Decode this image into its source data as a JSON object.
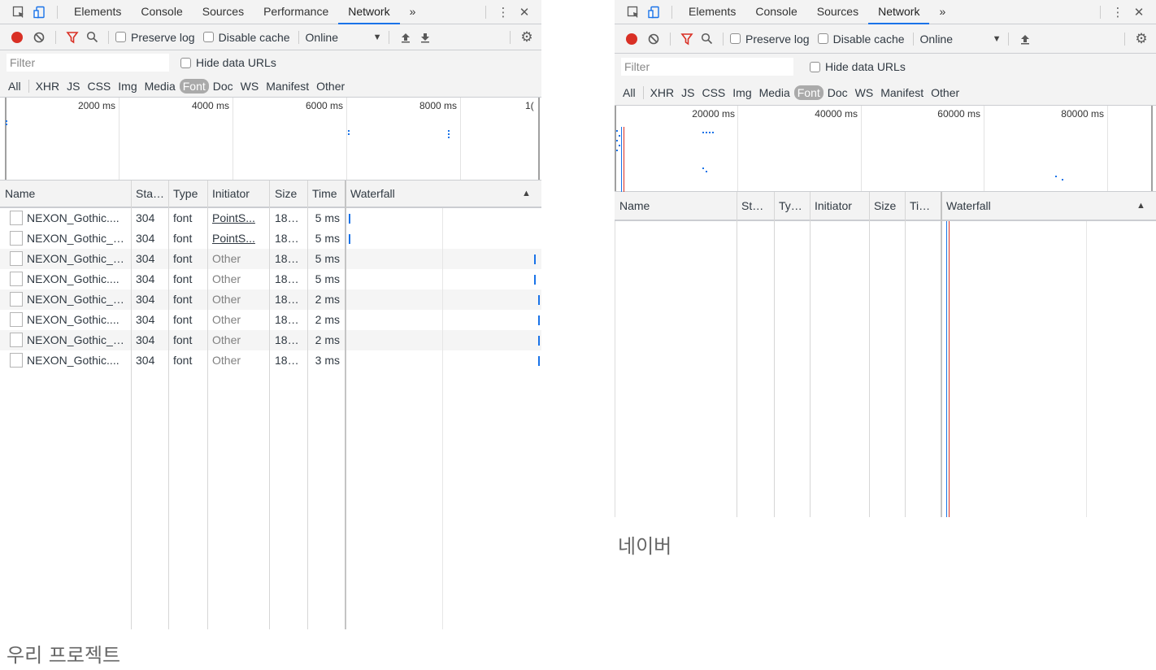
{
  "panels": [
    {
      "tabs": [
        "Elements",
        "Console",
        "Sources",
        "Performance",
        "Network"
      ],
      "selected_tab": "Network",
      "more_tabs": "»",
      "toolbar": {
        "preserve_log": "Preserve log",
        "disable_cache": "Disable cache",
        "throttle": "Online"
      },
      "filter": {
        "placeholder": "Filter",
        "hide_data_urls": "Hide data URLs"
      },
      "type_filters": [
        "All",
        "XHR",
        "JS",
        "CSS",
        "Img",
        "Media",
        "Font",
        "Doc",
        "WS",
        "Manifest",
        "Other"
      ],
      "selected_type": "Font",
      "overview_labels": [
        "2000 ms",
        "4000 ms",
        "6000 ms",
        "8000 ms",
        "1("
      ],
      "columns": [
        "Name",
        "Sta…",
        "Type",
        "Initiator",
        "Size",
        "Time",
        "Waterfall"
      ],
      "rows": [
        {
          "name": "NEXON_Gothic....",
          "status": "304",
          "type": "font",
          "initiator": "PointS...",
          "size": "18…",
          "time": "5 ms"
        },
        {
          "name": "NEXON_Gothic_…",
          "status": "304",
          "type": "font",
          "initiator": "PointS...",
          "size": "18…",
          "time": "5 ms"
        },
        {
          "name": "NEXON_Gothic_…",
          "status": "304",
          "type": "font",
          "initiator": "Other",
          "size": "18…",
          "time": "5 ms"
        },
        {
          "name": "NEXON_Gothic....",
          "status": "304",
          "type": "font",
          "initiator": "Other",
          "size": "18…",
          "time": "5 ms"
        },
        {
          "name": "NEXON_Gothic_…",
          "status": "304",
          "type": "font",
          "initiator": "Other",
          "size": "18…",
          "time": "2 ms"
        },
        {
          "name": "NEXON_Gothic....",
          "status": "304",
          "type": "font",
          "initiator": "Other",
          "size": "18…",
          "time": "2 ms"
        },
        {
          "name": "NEXON_Gothic_…",
          "status": "304",
          "type": "font",
          "initiator": "Other",
          "size": "18…",
          "time": "2 ms"
        },
        {
          "name": "NEXON_Gothic....",
          "status": "304",
          "type": "font",
          "initiator": "Other",
          "size": "18…",
          "time": "3 ms"
        }
      ],
      "caption": "우리 프로젝트"
    },
    {
      "tabs": [
        "Elements",
        "Console",
        "Sources",
        "Network"
      ],
      "selected_tab": "Network",
      "more_tabs": "»",
      "toolbar": {
        "preserve_log": "Preserve log",
        "disable_cache": "Disable cache",
        "throttle": "Online"
      },
      "filter": {
        "placeholder": "Filter",
        "hide_data_urls": "Hide data URLs"
      },
      "type_filters": [
        "All",
        "XHR",
        "JS",
        "CSS",
        "Img",
        "Media",
        "Font",
        "Doc",
        "WS",
        "Manifest",
        "Other"
      ],
      "selected_type": "Font",
      "overview_labels": [
        "20000 ms",
        "40000 ms",
        "60000 ms",
        "80000 ms"
      ],
      "columns": [
        "Name",
        "St…",
        "Ty…",
        "Initiator",
        "Size",
        "Ti…",
        "Waterfall"
      ],
      "rows": [],
      "caption": "네이버"
    }
  ],
  "colors": {
    "accent": "#1a73e8",
    "record": "#d93025",
    "filter_icon": "#d93025",
    "selected_type_bg": "#aaaaaa"
  },
  "icons": [
    "inspect-icon",
    "device-icon",
    "more-icon",
    "close-icon",
    "record-icon",
    "clear-icon",
    "filter-icon",
    "search-icon",
    "dropdown-icon",
    "import-icon",
    "export-icon",
    "gear-icon"
  ]
}
